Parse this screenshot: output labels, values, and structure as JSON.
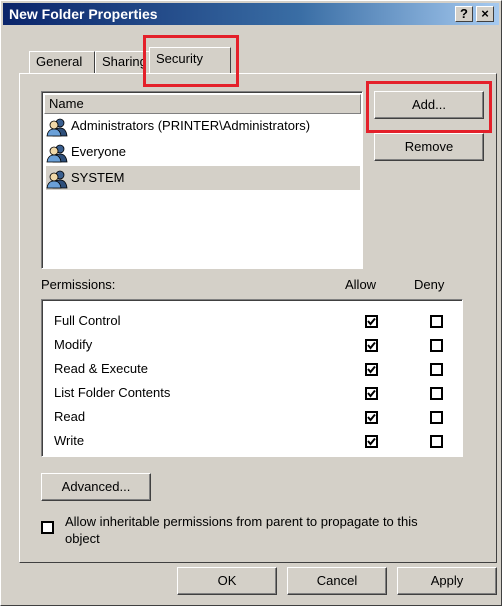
{
  "window": {
    "title": "New Folder Properties",
    "help_label": "?",
    "close_label": "×"
  },
  "tabs": [
    {
      "label": "General",
      "active": false
    },
    {
      "label": "Sharing",
      "active": false
    },
    {
      "label": "Security",
      "active": true
    }
  ],
  "names_list": {
    "header": "Name",
    "items": [
      {
        "label": "Administrators (PRINTER\\Administrators)",
        "selected": false,
        "icon": "users-group-icon"
      },
      {
        "label": "Everyone",
        "selected": false,
        "icon": "users-group-icon"
      },
      {
        "label": "SYSTEM",
        "selected": true,
        "icon": "users-group-icon"
      }
    ]
  },
  "buttons": {
    "add": "Add...",
    "remove": "Remove",
    "advanced": "Advanced...",
    "ok": "OK",
    "cancel": "Cancel",
    "apply": "Apply"
  },
  "permissions": {
    "label": "Permissions:",
    "allow_header": "Allow",
    "deny_header": "Deny",
    "rows": [
      {
        "name": "Full Control",
        "allow": true,
        "deny": false
      },
      {
        "name": "Modify",
        "allow": true,
        "deny": false
      },
      {
        "name": "Read & Execute",
        "allow": true,
        "deny": false
      },
      {
        "name": "List Folder Contents",
        "allow": true,
        "deny": false
      },
      {
        "name": "Read",
        "allow": true,
        "deny": false
      },
      {
        "name": "Write",
        "allow": true,
        "deny": false
      }
    ]
  },
  "inherit": {
    "checked": false,
    "line1": "Allow inheritable permissions from parent to propagate to this",
    "line2": "object"
  },
  "colors": {
    "title_gradient_start": "#0a246a",
    "dialog_face": "#d4d0c8",
    "highlight_box": "#e4202a"
  }
}
